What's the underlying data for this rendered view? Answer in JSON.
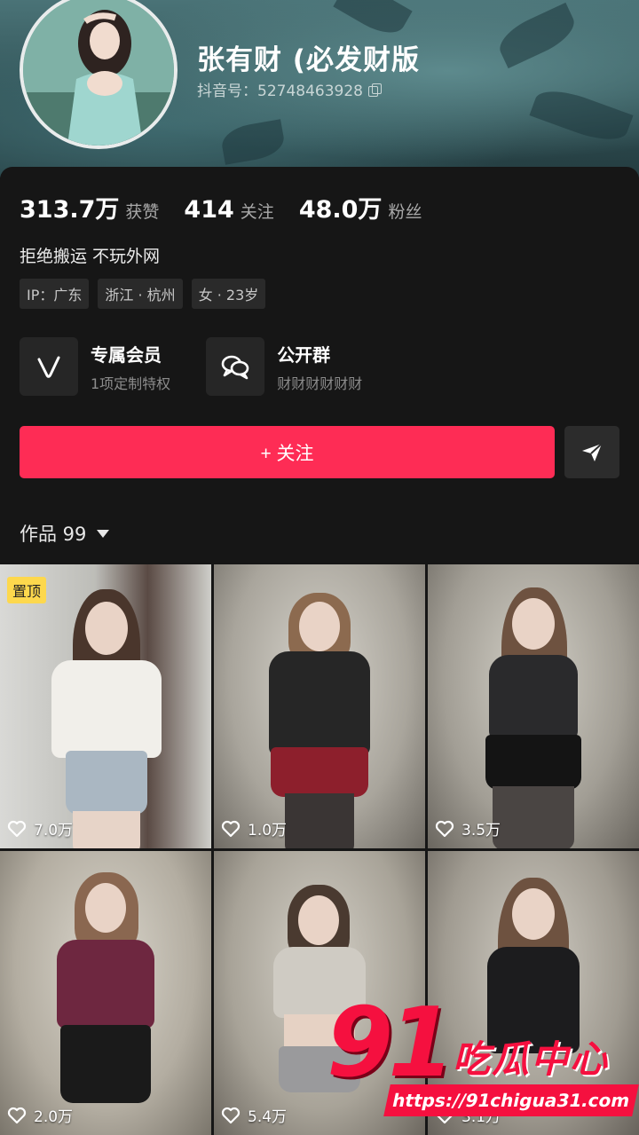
{
  "profile": {
    "name": "张有财 (必发财版",
    "id_label": "抖音号：52748463928"
  },
  "stats": [
    {
      "value": "313.7万",
      "label": "获赞"
    },
    {
      "value": "414",
      "label": "关注"
    },
    {
      "value": "48.0万",
      "label": "粉丝"
    }
  ],
  "bio": "拒绝搬运 不玩外网",
  "tags": [
    "IP：广东",
    "浙江 · 杭州",
    "女 · 23岁"
  ],
  "features": [
    {
      "title": "专属会员",
      "subtitle": "1项定制特权",
      "icon": "vip-v-icon"
    },
    {
      "title": "公开群",
      "subtitle": "财财财财财财",
      "icon": "group-chat-icon"
    }
  ],
  "follow_button": {
    "label": "+ 关注"
  },
  "works": {
    "label": "作品 99"
  },
  "grid": [
    {
      "likes": "7.0万",
      "pinned": "置顶"
    },
    {
      "likes": "1.0万"
    },
    {
      "likes": "3.5万"
    },
    {
      "likes": "2.0万"
    },
    {
      "likes": "5.4万"
    },
    {
      "likes": "3.1万"
    }
  ],
  "watermark": {
    "number": "91",
    "text": "吃瓜中心",
    "url": "https://91chigua31.com"
  },
  "colors": {
    "accent": "#fe2c55",
    "pin_badge": "#fdd84d",
    "background": "#161616"
  }
}
